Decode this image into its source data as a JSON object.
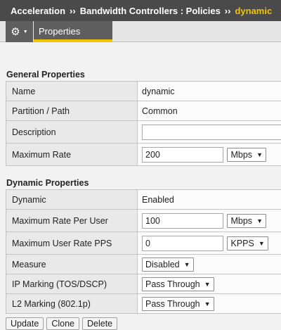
{
  "breadcrumb": {
    "items": [
      "Acceleration",
      "Bandwidth Controllers : Policies"
    ],
    "current": "dynamic",
    "separator": "››"
  },
  "tabs": {
    "gear_icon": "gear-icon",
    "active_label": "Properties"
  },
  "general": {
    "title": "General Properties",
    "name_label": "Name",
    "name_value": "dynamic",
    "partition_label": "Partition / Path",
    "partition_value": "Common",
    "description_label": "Description",
    "description_value": "",
    "max_rate_label": "Maximum Rate",
    "max_rate_value": "200",
    "max_rate_unit": "Mbps"
  },
  "dynamic": {
    "title": "Dynamic Properties",
    "dynamic_label": "Dynamic",
    "dynamic_value": "Enabled",
    "max_rate_user_label": "Maximum Rate Per User",
    "max_rate_user_value": "100",
    "max_rate_user_unit": "Mbps",
    "max_user_pps_label": "Maximum User Rate PPS",
    "max_user_pps_value": "0",
    "max_user_pps_unit": "KPPS",
    "measure_label": "Measure",
    "measure_value": "Disabled",
    "ip_marking_label": "IP Marking (TOS/DSCP)",
    "ip_marking_value": "Pass Through",
    "l2_marking_label": "L2 Marking (802.1p)",
    "l2_marking_value": "Pass Through"
  },
  "buttons": {
    "update": "Update",
    "clone": "Clone",
    "delete": "Delete"
  },
  "colors": {
    "header_bg": "#4a4a4a",
    "accent": "#f5c400",
    "tab_bg": "#5e5e5e"
  }
}
